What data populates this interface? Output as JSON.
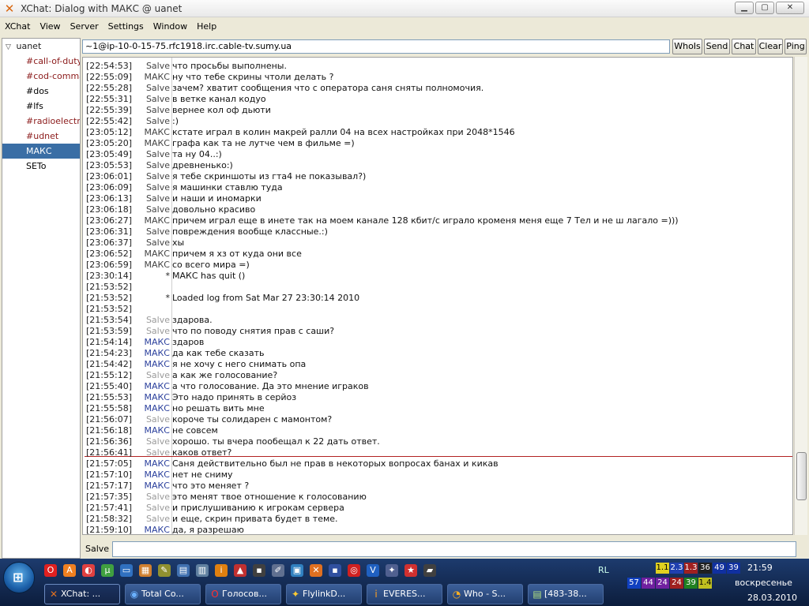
{
  "window": {
    "title": "XChat: Dialog with МАКС @ uanet"
  },
  "menu": [
    "XChat",
    "View",
    "Server",
    "Settings",
    "Window",
    "Help"
  ],
  "tree": {
    "server": "uanet",
    "channels": [
      {
        "label": "#call-of-duty",
        "style": "red"
      },
      {
        "label": "#cod-commar",
        "style": "red"
      },
      {
        "label": "#dos",
        "style": "plain"
      },
      {
        "label": "#lfs",
        "style": "plain"
      },
      {
        "label": "#radioelectroi",
        "style": "red"
      },
      {
        "label": "#udnet",
        "style": "red"
      },
      {
        "label": "МАКС",
        "style": "selected"
      },
      {
        "label": "SETo",
        "style": "plain"
      }
    ]
  },
  "topic": "~1@ip-10-0-15-75.rfc1918.irc.cable-tv.sumy.ua",
  "top_buttons": [
    "WhoIs",
    "Send",
    "Chat",
    "Clear",
    "Ping"
  ],
  "scrollbar": {
    "position": 0.92,
    "visible": 0.1
  },
  "messages": [
    {
      "ts": "[22:54:53]",
      "nick": "Salve",
      "c": "old",
      "text": "что просьбы   выполнены."
    },
    {
      "ts": "[22:55:09]",
      "nick": "МАКС",
      "c": "old",
      "text": "ну что тебе скрины чтоли делать ?"
    },
    {
      "ts": "[22:55:28]",
      "nick": "Salve",
      "c": "old",
      "text": "зачем? хватит сообщения что с оператора саня сняты полномочия."
    },
    {
      "ts": "[22:55:31]",
      "nick": "Salve",
      "c": "old",
      "text": "в ветке канал кодуо"
    },
    {
      "ts": "[22:55:39]",
      "nick": "Salve",
      "c": "old",
      "text": "вернее кол оф дьюти"
    },
    {
      "ts": "[22:55:42]",
      "nick": "Salve",
      "c": "old",
      "text": ":)"
    },
    {
      "ts": "[23:05:12]",
      "nick": "МАКС",
      "c": "old",
      "text": "кстате играл в колин макрей ралли 04 на всех настройках при 2048*1546"
    },
    {
      "ts": "[23:05:20]",
      "nick": "МАКС",
      "c": "old",
      "text": "графа как та не лутче чем в фильме =)"
    },
    {
      "ts": "[23:05:49]",
      "nick": "Salve",
      "c": "old",
      "text": "та ну 04..:)"
    },
    {
      "ts": "[23:05:53]",
      "nick": "Salve",
      "c": "old",
      "text": "древненько:)"
    },
    {
      "ts": "[23:06:01]",
      "nick": "Salve",
      "c": "old",
      "text": "я тебе скриншоты из гта4 не показывал?)"
    },
    {
      "ts": "[23:06:09]",
      "nick": "Salve",
      "c": "old",
      "text": "я машинки ставлю туда"
    },
    {
      "ts": "[23:06:13]",
      "nick": "Salve",
      "c": "old",
      "text": "и наши и иномарки"
    },
    {
      "ts": "[23:06:18]",
      "nick": "Salve",
      "c": "old",
      "text": "довольно красиво"
    },
    {
      "ts": "[23:06:27]",
      "nick": "МАКС",
      "c": "old",
      "text": "причем играл еще в инете так на моем канале 128 кбит/с играло кроменя меня еще 7 Тел и не ш лагало =)))"
    },
    {
      "ts": "[23:06:31]",
      "nick": "Salve",
      "c": "old",
      "text": "повреждения вообще классные.:)"
    },
    {
      "ts": "[23:06:37]",
      "nick": "Salve",
      "c": "old",
      "text": "хы"
    },
    {
      "ts": "[23:06:52]",
      "nick": "МАКС",
      "c": "old",
      "text": "причем я хз от куда они все"
    },
    {
      "ts": "[23:06:59]",
      "nick": "МАКС",
      "c": "old",
      "text": "со всего мира =)"
    },
    {
      "ts": "[23:30:14]",
      "nick": "*",
      "c": "sys",
      "text": "МАКС has quit ()"
    },
    {
      "ts": "[21:53:52]",
      "nick": "",
      "c": "sys",
      "text": ""
    },
    {
      "ts": "[21:53:52]",
      "nick": "*",
      "c": "sys",
      "text": "Loaded log from Sat Mar 27 23:30:14 2010"
    },
    {
      "ts": "[21:53:52]",
      "nick": "",
      "c": "sys",
      "text": ""
    },
    {
      "ts": "[21:53:54]",
      "nick": "Salve",
      "c": "salve",
      "text": "здарова."
    },
    {
      "ts": "[21:53:59]",
      "nick": "Salve",
      "c": "salve",
      "text": "что по поводу снятия прав с саши?"
    },
    {
      "ts": "[21:54:14]",
      "nick": "МАКС",
      "c": "maks",
      "text": "здаров"
    },
    {
      "ts": "[21:54:23]",
      "nick": "МАКС",
      "c": "maks",
      "text": "да как тебе сказать"
    },
    {
      "ts": "[21:54:42]",
      "nick": "МАКС",
      "c": "maks",
      "text": "я не хочу с него снимать опа"
    },
    {
      "ts": "[21:55:12]",
      "nick": "Salve",
      "c": "salve",
      "text": "а как же голосование?"
    },
    {
      "ts": "[21:55:40]",
      "nick": "МАКС",
      "c": "maks",
      "text": "а что голосование. Да это мнение играков"
    },
    {
      "ts": "[21:55:53]",
      "nick": "МАКС",
      "c": "maks",
      "text": "Это надо принять в серйоз"
    },
    {
      "ts": "[21:55:58]",
      "nick": "МАКС",
      "c": "maks",
      "text": "но решать вить мне"
    },
    {
      "ts": "[21:56:07]",
      "nick": "Salve",
      "c": "salve",
      "text": "короче ты солидарен с мамонтом?"
    },
    {
      "ts": "[21:56:18]",
      "nick": "МАКС",
      "c": "maks",
      "text": "не совсем"
    },
    {
      "ts": "[21:56:36]",
      "nick": "Salve",
      "c": "salve",
      "text": "хорошо. ты вчера пообещал к 22 дать ответ."
    },
    {
      "ts": "[21:56:41]",
      "nick": "Salve",
      "c": "salve",
      "text": "каков ответ?"
    },
    {
      "ts": "[21:57:05]",
      "nick": "МАКС",
      "c": "maks",
      "text": "Саня действительно был не прав в некоторых вопросах банах и кикав"
    },
    {
      "ts": "[21:57:10]",
      "nick": "МАКС",
      "c": "maks",
      "text": "нет не сниму"
    },
    {
      "ts": "[21:57:17]",
      "nick": "МАКС",
      "c": "maks",
      "text": "что это меняет ?"
    },
    {
      "ts": "[21:57:35]",
      "nick": "Salve",
      "c": "salve",
      "text": "это менят твое отношение к голосованию"
    },
    {
      "ts": "[21:57:41]",
      "nick": "Salve",
      "c": "salve",
      "text": "и прислушиванию к игрокам сервера"
    },
    {
      "ts": "[21:58:32]",
      "nick": "Salve",
      "c": "salve",
      "text": "и еще, скрин привата будет в теме."
    },
    {
      "ts": "[21:59:10]",
      "nick": "МАКС",
      "c": "maks",
      "text": "да, я разрешаю"
    }
  ],
  "input": {
    "nick": "Salve",
    "value": ""
  },
  "taskbar": {
    "tasks": [
      {
        "label": "XChat: ...",
        "icon": "xchat-icon",
        "glyph": "✕",
        "color": "#e07020"
      },
      {
        "label": "Total Co...",
        "icon": "total-commander-icon",
        "glyph": "◉",
        "color": "#6ab0ff"
      },
      {
        "label": "Голосов...",
        "icon": "opera-icon",
        "glyph": "O",
        "color": "#ff3030"
      },
      {
        "label": "FlylinkD...",
        "icon": "flylink-icon",
        "glyph": "✦",
        "color": "#ffcc33"
      },
      {
        "label": "EVERES...",
        "icon": "everest-icon",
        "glyph": "i",
        "color": "#ffa020"
      },
      {
        "label": "Who - S...",
        "icon": "who-icon",
        "glyph": "◔",
        "color": "#ffb020"
      },
      {
        "label": "[483-38...",
        "icon": "notepad-icon",
        "glyph": "▤",
        "color": "#b0e080"
      }
    ],
    "lang": "RL",
    "tray_badges_top": [
      {
        "text": "1.1",
        "bg": "#e0d020",
        "fg": "#000"
      },
      {
        "text": "2.3",
        "bg": "#2040b0",
        "fg": "#fff"
      },
      {
        "text": "1.3",
        "bg": "#a02020",
        "fg": "#fff"
      },
      {
        "text": "36",
        "bg": "#202020",
        "fg": "#fff"
      },
      {
        "text": "49",
        "bg": "#1030a0",
        "fg": "#fff"
      },
      {
        "text": "39",
        "bg": "#1030a0",
        "fg": "#fff"
      }
    ],
    "tray_badges_bottom": [
      {
        "text": "57",
        "bg": "#1040c0",
        "fg": "#fff"
      },
      {
        "text": "44",
        "bg": "#7020a0",
        "fg": "#fff"
      },
      {
        "text": "24",
        "bg": "#7020a0",
        "fg": "#fff"
      },
      {
        "text": "24",
        "bg": "#a02020",
        "fg": "#fff"
      },
      {
        "text": "39",
        "bg": "#208020",
        "fg": "#fff"
      },
      {
        "text": "1.4",
        "bg": "#c0c020",
        "fg": "#000"
      }
    ],
    "clock_time": "21:59",
    "clock_day": "воскресенье",
    "clock_date": "28.03.2010"
  }
}
